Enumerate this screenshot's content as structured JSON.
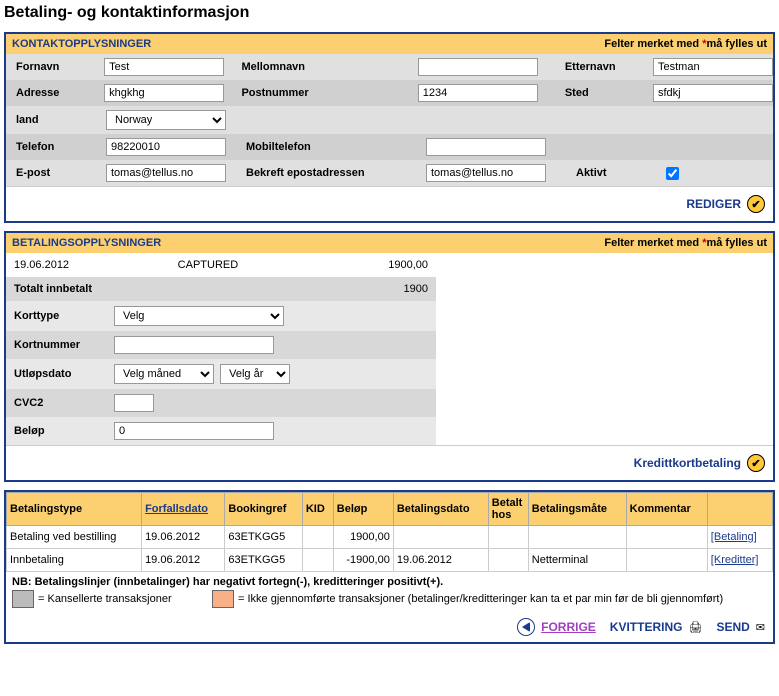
{
  "page_title": "Betaling- og kontaktinformasjon",
  "contact": {
    "section_title": "KONTAKTOPPLYSNINGER",
    "required_text_prefix": "Felter merket med ",
    "required_text_suffix": "må fylles ut",
    "labels": {
      "fornavn": "Fornavn",
      "mellomnavn": "Mellomnavn",
      "etternavn": "Etternavn",
      "adresse": "Adresse",
      "postnummer": "Postnummer",
      "sted": "Sted",
      "land": "land",
      "telefon": "Telefon",
      "mobil": "Mobiltelefon",
      "epost": "E-post",
      "bekreft_epost": "Bekreft epostadressen",
      "aktivt": "Aktivt"
    },
    "values": {
      "fornavn": "Test",
      "mellomnavn": "",
      "etternavn": "Testman",
      "adresse": "khgkhg",
      "postnummer": "1234",
      "sted": "sfdkj",
      "land": "Norway",
      "telefon": "98220010",
      "mobil": "",
      "epost": "tomas@tellus.no",
      "bekreft_epost": "tomas@tellus.no"
    },
    "edit_button": "REDIGER"
  },
  "payment": {
    "section_title": "BETALINGSOPPLYSNINGER",
    "required_text_prefix": "Felter merket med ",
    "required_text_suffix": "må fylles ut",
    "capture_date": "19.06.2012",
    "capture_status": "CAPTURED",
    "capture_amount": "1900,00",
    "total_label": "Totalt innbetalt",
    "total_value": "1900",
    "labels": {
      "korttype": "Korttype",
      "kortnummer": "Kortnummer",
      "utlopsdato": "Utløpsdato",
      "cvc2": "CVC2",
      "belop": "Beløp"
    },
    "values": {
      "korttype": "Velg",
      "kortnummer": "",
      "maned": "Velg måned",
      "ar": "Velg år",
      "cvc2": "",
      "belop": "0"
    },
    "submit_button": "Kredittkortbetaling"
  },
  "table": {
    "headers": {
      "betalingstype": "Betalingstype",
      "forfallsdato": "Forfallsdato",
      "bookingref": "Bookingref",
      "kid": "KID",
      "belop": "Beløp",
      "betalingsdato": "Betalingsdato",
      "betalt_hos": "Betalt hos",
      "betalingsmate": "Betalingsmåte",
      "kommentar": "Kommentar",
      "action": ""
    },
    "rows": [
      {
        "betalingstype": "Betaling ved bestilling",
        "forfallsdato": "19.06.2012",
        "bookingref": "63ETKGG5",
        "kid": "",
        "belop": "1900,00",
        "betalingsdato": "",
        "betalt_hos": "",
        "betalingsmate": "",
        "kommentar": "",
        "action": "[Betaling]"
      },
      {
        "betalingstype": "Innbetaling",
        "forfallsdato": "19.06.2012",
        "bookingref": "63ETKGG5",
        "kid": "",
        "belop": "-1900,00",
        "betalingsdato": "19.06.2012",
        "betalt_hos": "",
        "betalingsmate": "Netterminal",
        "kommentar": "",
        "action": "[Kreditter]"
      }
    ],
    "legend": {
      "nb": "NB: Betalingslinjer (innbetalinger) har negativt fortegn(-), kreditteringer positivt(+).",
      "gray": "= Kansellerte transaksjoner",
      "orange": "= Ikke gjennomførte transaksjoner (betalinger/kreditteringer kan ta et par min før de bli gjennomført)"
    }
  },
  "footer": {
    "forrige": "FORRIGE",
    "kvittering": "KVITTERING",
    "send": "SEND"
  }
}
